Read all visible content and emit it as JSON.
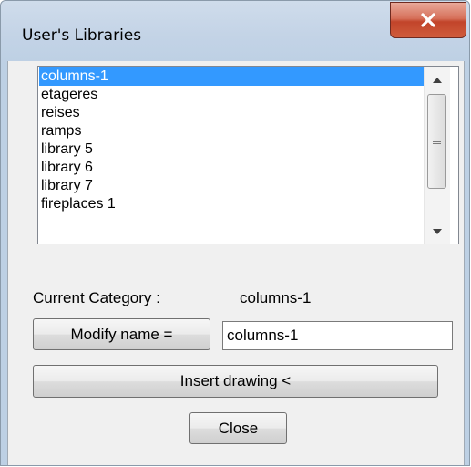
{
  "window": {
    "title": "User's Libraries",
    "close_icon": "close-x-icon"
  },
  "categories": {
    "items": [
      "columns-1",
      "etageres",
      "reises",
      "ramps",
      "library 5",
      "library 6",
      "library 7",
      "fireplaces 1"
    ],
    "selected": "columns-1"
  },
  "current_category": {
    "label": "Current Category :",
    "value": "columns-1"
  },
  "modify": {
    "button_label": "Modify name =",
    "input_value": "columns-1"
  },
  "insert_button_label": "Insert drawing <",
  "close_button_label": "Close",
  "colors": {
    "selection": "#3399ff",
    "close_button": "#c9452b",
    "dialog_background": "#f0f0f0"
  }
}
